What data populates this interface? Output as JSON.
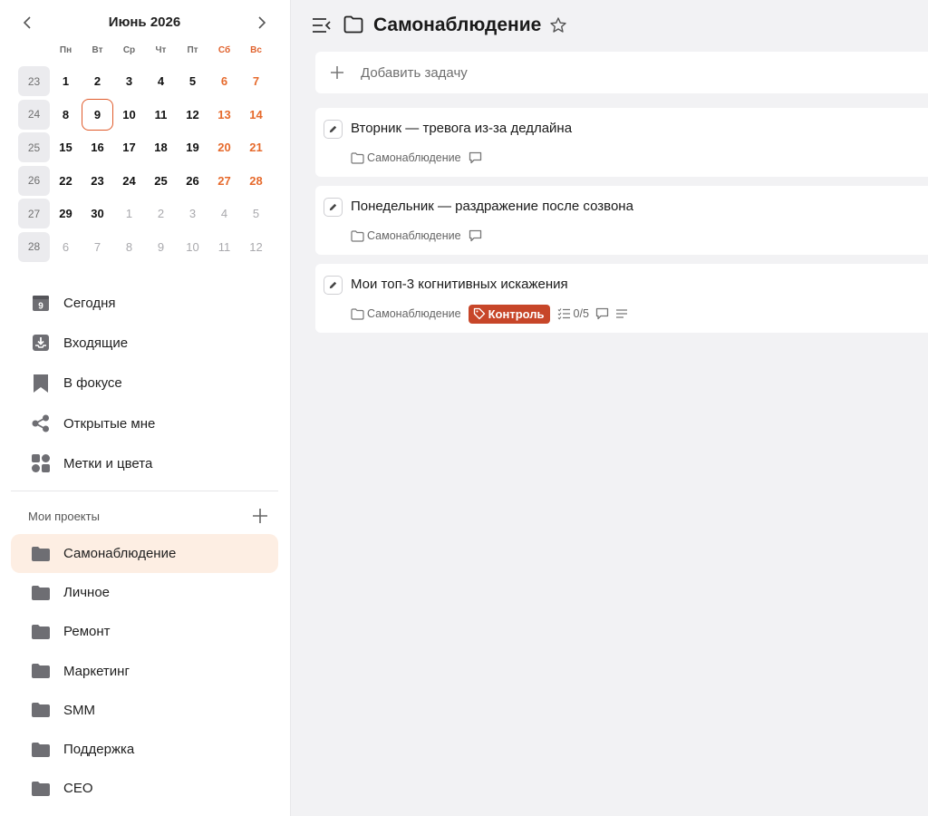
{
  "calendar": {
    "title": "Июнь 2026",
    "weekdays": [
      "Пн",
      "Вт",
      "Ср",
      "Чт",
      "Пт",
      "Сб",
      "Вс"
    ],
    "weeks": [
      {
        "num": "23",
        "days": [
          "1",
          "2",
          "3",
          "4",
          "5",
          "6",
          "7"
        ]
      },
      {
        "num": "24",
        "days": [
          "8",
          "9",
          "10",
          "11",
          "12",
          "13",
          "14"
        ]
      },
      {
        "num": "25",
        "days": [
          "15",
          "16",
          "17",
          "18",
          "19",
          "20",
          "21"
        ]
      },
      {
        "num": "26",
        "days": [
          "22",
          "23",
          "24",
          "25",
          "26",
          "27",
          "28"
        ]
      },
      {
        "num": "27",
        "days": [
          "29",
          "30",
          "1",
          "2",
          "3",
          "4",
          "5"
        ]
      },
      {
        "num": "28",
        "days": [
          "6",
          "7",
          "8",
          "9",
          "10",
          "11",
          "12"
        ]
      }
    ],
    "selected_day": "9"
  },
  "nav": {
    "today_icon_num": "9",
    "items": [
      {
        "label": "Сегодня",
        "icon": "calendar-today-icon"
      },
      {
        "label": "Входящие",
        "icon": "inbox-icon"
      },
      {
        "label": "В фокусе",
        "icon": "bookmark-icon"
      },
      {
        "label": "Открытые мне",
        "icon": "share-icon"
      },
      {
        "label": "Метки и цвета",
        "icon": "tags-grid-icon"
      }
    ]
  },
  "projects": {
    "title": "Мои проекты",
    "items": [
      {
        "label": "Самонаблюдение",
        "active": true
      },
      {
        "label": "Личное"
      },
      {
        "label": "Ремонт"
      },
      {
        "label": "Маркетинг"
      },
      {
        "label": "SMM"
      },
      {
        "label": "Поддержка"
      },
      {
        "label": "CEO"
      }
    ]
  },
  "main": {
    "title": "Самонаблюдение",
    "add_task_label": "Добавить задачу",
    "tasks": [
      {
        "title": "Вторник — тревога из-за дедлайна",
        "project": "Самонаблюдение"
      },
      {
        "title": "Понедельник — раздражение после созвона",
        "project": "Самонаблюдение"
      },
      {
        "title": "Мои топ-3 когнитивных искажения",
        "project": "Самонаблюдение",
        "tag": "Контроль",
        "checklist": "0/5"
      }
    ]
  },
  "colors": {
    "accent": "#e05a2a",
    "weekend": "#e66a2c",
    "tag_bg": "#c74629",
    "active_project_bg": "#fdeee3",
    "icon_gray": "#6e6e73"
  }
}
